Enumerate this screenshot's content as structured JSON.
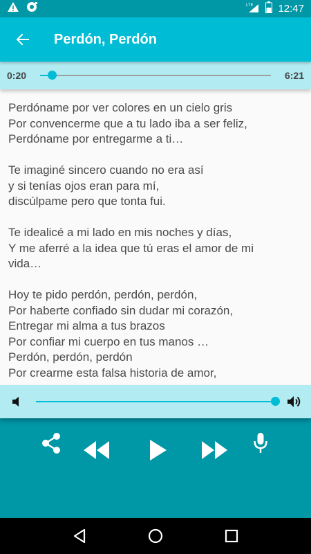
{
  "status_bar": {
    "time": "12:47",
    "network": "LTE",
    "icons": [
      "warning-icon",
      "notification-icon",
      "signal-icon",
      "battery-icon"
    ]
  },
  "app_bar": {
    "title": "Perdón, Perdón",
    "back_icon": "arrow-back-icon"
  },
  "player": {
    "elapsed": "0:20",
    "duration": "6:21",
    "progress": 0.05
  },
  "lyrics": {
    "lines": [
      "Perdóname por ver colores en un cielo gris",
      "Por convencerme que a tu lado iba a ser feliz,",
      "Perdóname por entregarme a ti…",
      "",
      "Te imaginé sincero cuando no era así",
      "y si tenías ojos eran para mí,",
      "discúlpame pero que tonta fui.",
      "",
      "Te idealicé a mi lado en mis noches y días,",
      "Y me aferré a la idea que tú eras el amor de mi",
      "vida…",
      "",
      "Hoy te pido perdón, perdón, perdón,",
      "Por haberte confiado sin dudar mi corazón,",
      "Entregar mi alma a tus brazos",
      "Por confiar mi cuerpo en tus manos …",
      "Perdón, perdón, perdón",
      "Por crearme esta falsa historia de amor,"
    ]
  },
  "volume": {
    "level": 1.0,
    "low_icon": "volume-down-icon",
    "high_icon": "volume-up-icon"
  },
  "controls": {
    "icons": [
      "share-icon",
      "rewind-icon",
      "play-icon",
      "fast-forward-icon",
      "microphone-icon"
    ]
  },
  "nav_bar": {
    "icons": [
      "back-triangle-icon",
      "home-circle-icon",
      "recents-square-icon"
    ]
  },
  "colors": {
    "primary": "#00bcd4",
    "primary_dark": "#0097a7",
    "primary_light": "#b2ebf2",
    "text": "#4a4a4a"
  }
}
